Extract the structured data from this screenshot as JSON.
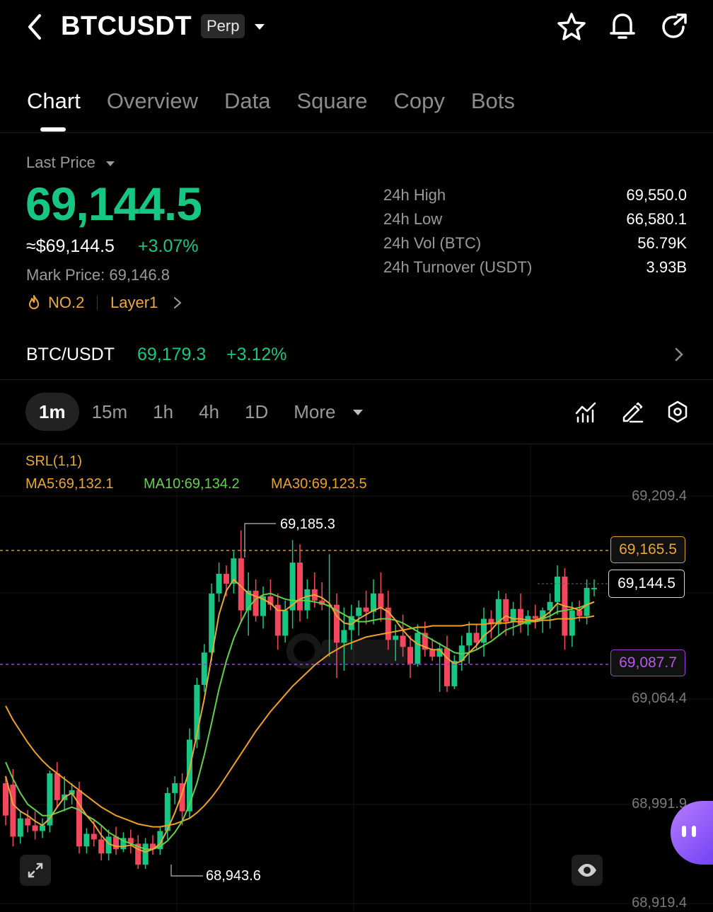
{
  "header": {
    "symbol": "BTCUSDT",
    "contract_type": "Perp"
  },
  "tabs": [
    {
      "label": "Chart",
      "active": true
    },
    {
      "label": "Overview"
    },
    {
      "label": "Data"
    },
    {
      "label": "Square"
    },
    {
      "label": "Copy"
    },
    {
      "label": "Bots"
    }
  ],
  "price": {
    "label": "Last Price",
    "last": "69,144.5",
    "usd": "≈$69,144.5",
    "change": "+3.07%",
    "mark": "Mark Price:  69,146.8",
    "rank": "NO.2",
    "sector": "Layer1",
    "up_color": "#16c784",
    "down_color": "#f6465d"
  },
  "stats": [
    {
      "label": "24h  High",
      "value": "69,550.0"
    },
    {
      "label": "24h  Low",
      "value": "66,580.1"
    },
    {
      "label": "24h  Vol (BTC)",
      "value": "56.79K"
    },
    {
      "label": "24h  Turnover (USDT)",
      "value": "3.93B"
    }
  ],
  "spot": {
    "pair": "BTC/USDT",
    "price": "69,179.3",
    "change": "+3.12%"
  },
  "intervals": [
    {
      "label": "1m",
      "active": true
    },
    {
      "label": "15m"
    },
    {
      "label": "1h"
    },
    {
      "label": "4h"
    },
    {
      "label": "1D"
    },
    {
      "label": "More"
    }
  ],
  "toolbar_icons": [
    "indicator-icon",
    "draw-icon",
    "settings-icon"
  ],
  "indicators": {
    "srl": "SRL(1,1)",
    "ma5": "MA5:69,132.1",
    "ma10": "MA10:69,134.2",
    "ma30": "MA30:69,123.5"
  },
  "chart_data": {
    "type": "candlestick",
    "yaxis_labels": [
      "69,209.4",
      "69,064.4",
      "68,991.9",
      "68,919.4"
    ],
    "ylim": [
      68919.4,
      69209.4
    ],
    "price_tags": {
      "ma_level": "69,165.5",
      "last": "69,144.5",
      "mark": "69,087.7"
    },
    "annotations": {
      "high": "69,185.3",
      "low": "68,943.6"
    },
    "series_colors": {
      "ma5": "#e9a832",
      "ma10": "#5fd24a",
      "ma30": "#f0a020"
    },
    "candles": [
      [
        69005,
        69010,
        68975,
        68982
      ],
      [
        69004,
        69015,
        68960,
        68967
      ],
      [
        68967,
        68985,
        68962,
        68980
      ],
      [
        68980,
        68986,
        68970,
        68975
      ],
      [
        68975,
        68985,
        68965,
        68971
      ],
      [
        68971,
        68980,
        68966,
        68975
      ],
      [
        68975,
        69014,
        68970,
        69012
      ],
      [
        69012,
        69020,
        68988,
        68993
      ],
      [
        68993,
        69010,
        68985,
        68997
      ],
      [
        68997,
        69005,
        68990,
        69000
      ],
      [
        69000,
        69006,
        68955,
        68960
      ],
      [
        68960,
        68973,
        68955,
        68969
      ],
      [
        68969,
        68979,
        68960,
        68965
      ],
      [
        68965,
        68975,
        68950,
        68955
      ],
      [
        68955,
        68972,
        68950,
        68967
      ],
      [
        68967,
        68974,
        68954,
        68958
      ],
      [
        68958,
        68970,
        68956,
        68966
      ],
      [
        68966,
        68972,
        68955,
        68962
      ],
      [
        68962,
        68968,
        68944,
        68947
      ],
      [
        68947,
        68966,
        68944,
        68962
      ],
      [
        68962,
        68968,
        68954,
        68958
      ],
      [
        68958,
        68974,
        68954,
        68971
      ],
      [
        68971,
        69002,
        68965,
        68998
      ],
      [
        68998,
        69010,
        68990,
        69005
      ],
      [
        69005,
        69012,
        68975,
        68985
      ],
      [
        68985,
        69044,
        68980,
        69036
      ],
      [
        69036,
        69080,
        69030,
        69075
      ],
      [
        69075,
        69104,
        69070,
        69098
      ],
      [
        69098,
        69147,
        69092,
        69140
      ],
      [
        69140,
        69162,
        69134,
        69154
      ],
      [
        69154,
        69160,
        69138,
        69147
      ],
      [
        69147,
        69170,
        69140,
        69165
      ],
      [
        69165,
        69185,
        69120,
        69128
      ],
      [
        69128,
        69155,
        69110,
        69142
      ],
      [
        69142,
        69150,
        69120,
        69124
      ],
      [
        69124,
        69145,
        69115,
        69138
      ],
      [
        69138,
        69150,
        69128,
        69132
      ],
      [
        69132,
        69140,
        69100,
        69110
      ],
      [
        69110,
        69135,
        69105,
        69128
      ],
      [
        69128,
        69178,
        69115,
        69162
      ],
      [
        69162,
        69175,
        69120,
        69128
      ],
      [
        69128,
        69150,
        69122,
        69143
      ],
      [
        69143,
        69155,
        69130,
        69135
      ],
      [
        69135,
        69148,
        69128,
        69132
      ],
      [
        69132,
        69168,
        69095,
        69132
      ],
      [
        69132,
        69140,
        69080,
        69105
      ],
      [
        69105,
        69130,
        69085,
        69114
      ],
      [
        69114,
        69132,
        69100,
        69124
      ],
      [
        69124,
        69135,
        69110,
        69130
      ],
      [
        69130,
        69142,
        69118,
        69127
      ],
      [
        69127,
        69150,
        69118,
        69140
      ],
      [
        69140,
        69155,
        69120,
        69130
      ],
      [
        69130,
        69142,
        69100,
        69107
      ],
      [
        69107,
        69118,
        69092,
        69110
      ],
      [
        69110,
        69125,
        69095,
        69102
      ],
      [
        69102,
        69110,
        69080,
        69090
      ],
      [
        69090,
        69118,
        69088,
        69112
      ],
      [
        69112,
        69120,
        69095,
        69100
      ],
      [
        69100,
        69108,
        69092,
        69095
      ],
      [
        69095,
        69105,
        69070,
        69101
      ],
      [
        69101,
        69110,
        69070,
        69074
      ],
      [
        69074,
        69096,
        69072,
        69092
      ],
      [
        69092,
        69110,
        69085,
        69103
      ],
      [
        69103,
        69120,
        69090,
        69112
      ],
      [
        69112,
        69118,
        69100,
        69105
      ],
      [
        69105,
        69130,
        69095,
        69122
      ],
      [
        69122,
        69128,
        69108,
        69118
      ],
      [
        69118,
        69142,
        69110,
        69136
      ],
      [
        69136,
        69140,
        69110,
        69120
      ],
      [
        69120,
        69134,
        69110,
        69129
      ],
      [
        69129,
        69140,
        69112,
        69118
      ],
      [
        69118,
        69128,
        69110,
        69124
      ],
      [
        69124,
        69132,
        69115,
        69122
      ],
      [
        69122,
        69130,
        69112,
        69128
      ],
      [
        69128,
        69140,
        69115,
        69134
      ],
      [
        69134,
        69160,
        69125,
        69152
      ],
      [
        69152,
        69158,
        69100,
        69110
      ],
      [
        69110,
        69134,
        69102,
        69128
      ],
      [
        69128,
        69135,
        69120,
        69124
      ],
      [
        69124,
        69150,
        69118,
        69144
      ],
      [
        69144,
        69150,
        69138,
        69144
      ]
    ],
    "ma5": [
      69010,
      68990,
      68985,
      68982,
      68978,
      68975,
      68980,
      68988,
      68995,
      68998,
      68990,
      68982,
      68976,
      68968,
      68962,
      68960,
      68960,
      68961,
      68958,
      68956,
      68958,
      68962,
      68972,
      68984,
      68998,
      69015,
      69040,
      69065,
      69095,
      69125,
      69142,
      69150,
      69145,
      69140,
      69138,
      69136,
      69133,
      69128,
      69128,
      69132,
      69136,
      69138,
      69139,
      69137,
      69133,
      69124,
      69119,
      69118,
      69122,
      69125,
      69128,
      69130,
      69127,
      69121,
      69114,
      69108,
      69104,
      69102,
      69100,
      69100,
      69094,
      69090,
      69092,
      69098,
      69103,
      69110,
      69114,
      69120,
      69124,
      69122,
      69122,
      69121,
      69121,
      69123,
      69127,
      69133,
      69131,
      69130,
      69128,
      69132,
      69134
    ],
    "ma10": [
      69020,
      69008,
      68998,
      68990,
      68986,
      68982,
      68982,
      68984,
      68986,
      68988,
      68986,
      68982,
      68979,
      68975,
      68970,
      68967,
      68964,
      68962,
      68960,
      68958,
      68958,
      68960,
      68964,
      68970,
      68978,
      68990,
      69005,
      69025,
      69048,
      69072,
      69092,
      69108,
      69120,
      69130,
      69136,
      69139,
      69140,
      69138,
      69136,
      69135,
      69135,
      69135,
      69134,
      69133,
      69131,
      69128,
      69125,
      69122,
      69120,
      69120,
      69121,
      69122,
      69122,
      69121,
      69119,
      69116,
      69113,
      69110,
      69107,
      69104,
      69101,
      69098,
      69097,
      69098,
      69100,
      69103,
      69106,
      69110,
      69114,
      69116,
      69118,
      69120,
      69121,
      69122,
      69124,
      69127,
      69128,
      69129,
      69130,
      69132,
      69134
    ],
    "ma30": [
      69060,
      69050,
      69042,
      69034,
      69027,
      69021,
      69016,
      69012,
      69008,
      69004,
      69000,
      68996,
      68992,
      68988,
      68985,
      68982,
      68980,
      68978,
      68976,
      68975,
      68974,
      68974,
      68975,
      68976,
      68978,
      68980,
      68984,
      68989,
      68995,
      69002,
      69010,
      69018,
      69026,
      69034,
      69042,
      69049,
      69056,
      69062,
      69068,
      69074,
      69079,
      69084,
      69089,
      69093,
      69097,
      69100,
      69103,
      69105,
      69107,
      69109,
      69110,
      69111,
      69112,
      69113,
      69114,
      69115,
      69116,
      69116,
      69117,
      69117,
      69117,
      69117,
      69117,
      69118,
      69118,
      69118,
      69119,
      69119,
      69119,
      69120,
      69120,
      69120,
      69120,
      69121,
      69121,
      69122,
      69122,
      69122,
      69123,
      69123,
      69124
    ]
  }
}
